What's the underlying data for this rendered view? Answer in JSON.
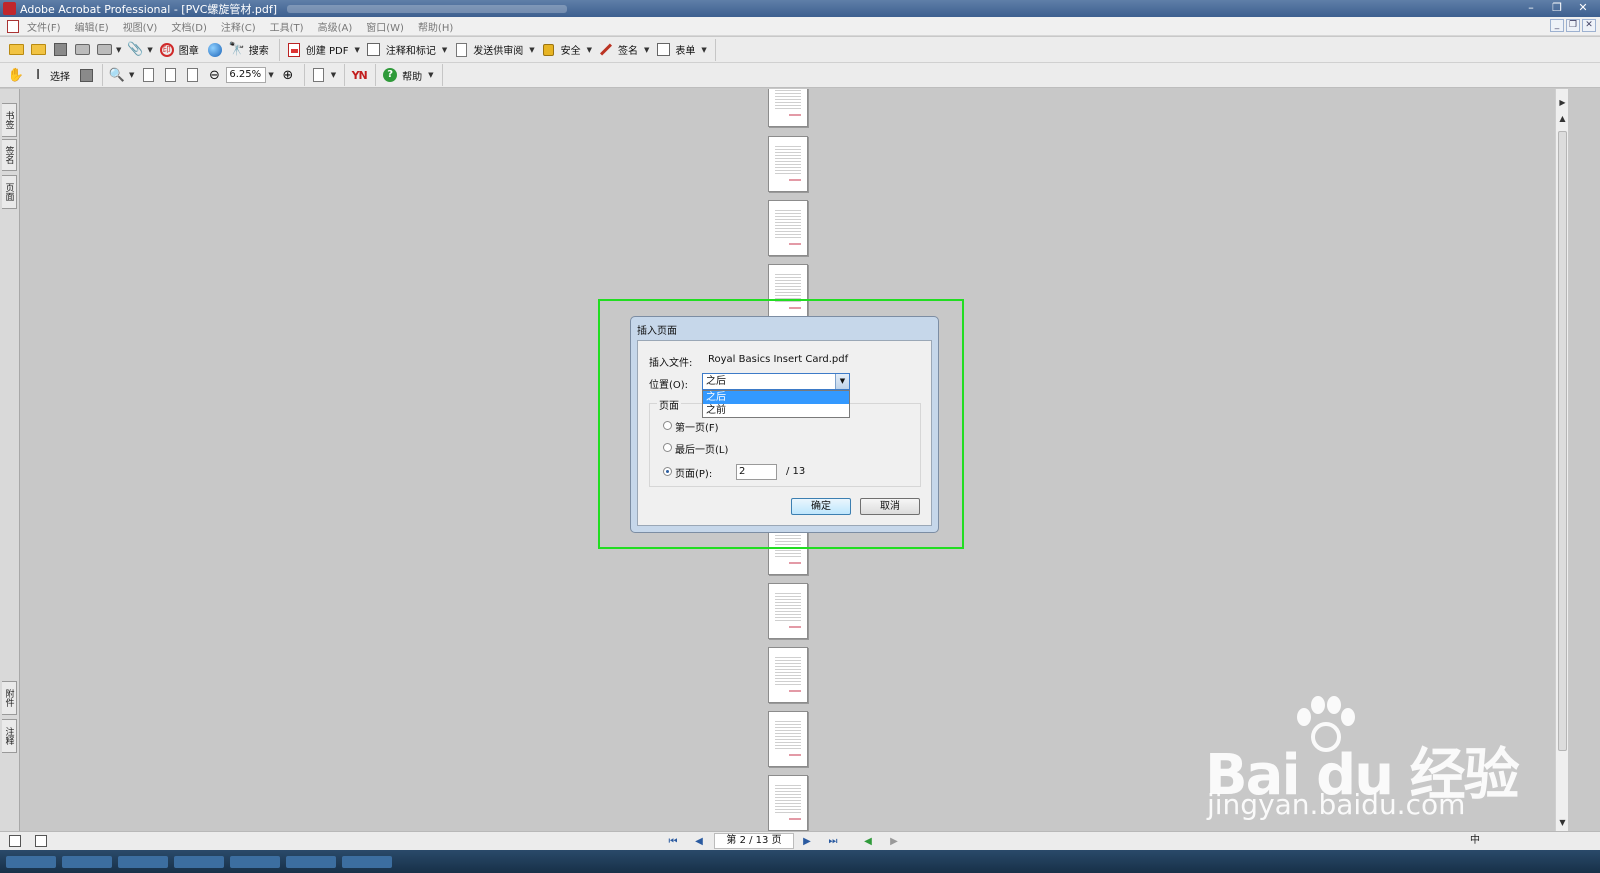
{
  "window": {
    "title": "Adobe Acrobat Professional - [PVC螺旋管材.pdf]",
    "minimize": "–",
    "restore": "❐",
    "close": "✕"
  },
  "menubar": {
    "items": [
      "文件(F)",
      "编辑(E)",
      "视图(V)",
      "文档(D)",
      "注释(C)",
      "工具(T)",
      "高级(A)",
      "窗口(W)",
      "帮助(H)"
    ]
  },
  "toolbar1": {
    "stamp": "图章",
    "search": "搜索",
    "create_pdf": "创建 PDF",
    "comment_markup": "注释和标记",
    "send_review": "发送供审阅",
    "security": "安全",
    "sign": "签名",
    "forms": "表单"
  },
  "toolbar2": {
    "select": "选择",
    "zoom_value": "6.25%",
    "help": "帮助",
    "yn_label": "YN"
  },
  "leftnav": {
    "tabs": [
      "书签",
      "签名",
      "页面",
      "附件",
      "注释"
    ]
  },
  "dialog": {
    "title": "插入页面",
    "insert_file_label": "插入文件:",
    "insert_file_name": "Royal Basics Insert Card.pdf",
    "position_label": "位置(O):",
    "position_value": "之后",
    "position_options": [
      "之后",
      "之前"
    ],
    "group_label": "页面",
    "first_page": "第一页(F)",
    "last_page": "最后一页(L)",
    "page_option": "页面(P):",
    "page_value": "2",
    "page_total": "/ 13",
    "ok": "确定",
    "cancel": "取消"
  },
  "statusbar": {
    "page_display": "第 2 / 13 页",
    "ime_text": "中"
  },
  "watermark": {
    "brand": "Bai du 经验",
    "url": "jingyan.baidu.com"
  },
  "icons": {
    "first_page": "⏮",
    "prev_page": "◀",
    "next_page": "▶",
    "last_page": "⏭",
    "back": "◀",
    "forward": "▶"
  }
}
